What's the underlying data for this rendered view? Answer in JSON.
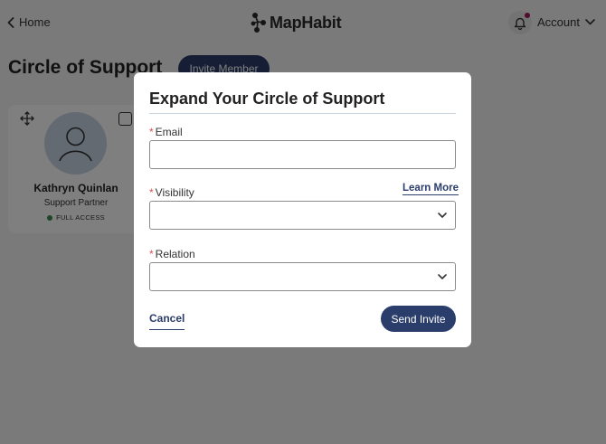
{
  "header": {
    "home_label": "Home",
    "logo_text": "MapHabit",
    "account_label": "Account",
    "notification_badge_color": "#a0175a"
  },
  "page": {
    "title": "Circle of Support",
    "invite_button_label": "Invite Member"
  },
  "members": [
    {
      "name": "Kathryn Quinlan",
      "role": "Support Partner",
      "access": "FULL ACCESS",
      "access_status_color": "#3d8a4e"
    }
  ],
  "modal": {
    "title": "Expand Your Circle of Support",
    "required_marker": "*",
    "fields": {
      "email": {
        "label": "Email",
        "value": "",
        "placeholder": ""
      },
      "visibility": {
        "label": "Visibility",
        "selected": "",
        "help_link": "Learn More"
      },
      "relation": {
        "label": "Relation",
        "selected": ""
      }
    },
    "cancel_label": "Cancel",
    "submit_label": "Send Invite"
  },
  "colors": {
    "brand_primary": "#2b3d6b",
    "required": "#d9534f",
    "overlay": "rgba(0,0,0,0.5)"
  },
  "icons": [
    "chevron-left-icon",
    "maphabit-logo-icon",
    "bell-icon",
    "chevron-down-icon",
    "move-icon",
    "avatar-icon"
  ]
}
